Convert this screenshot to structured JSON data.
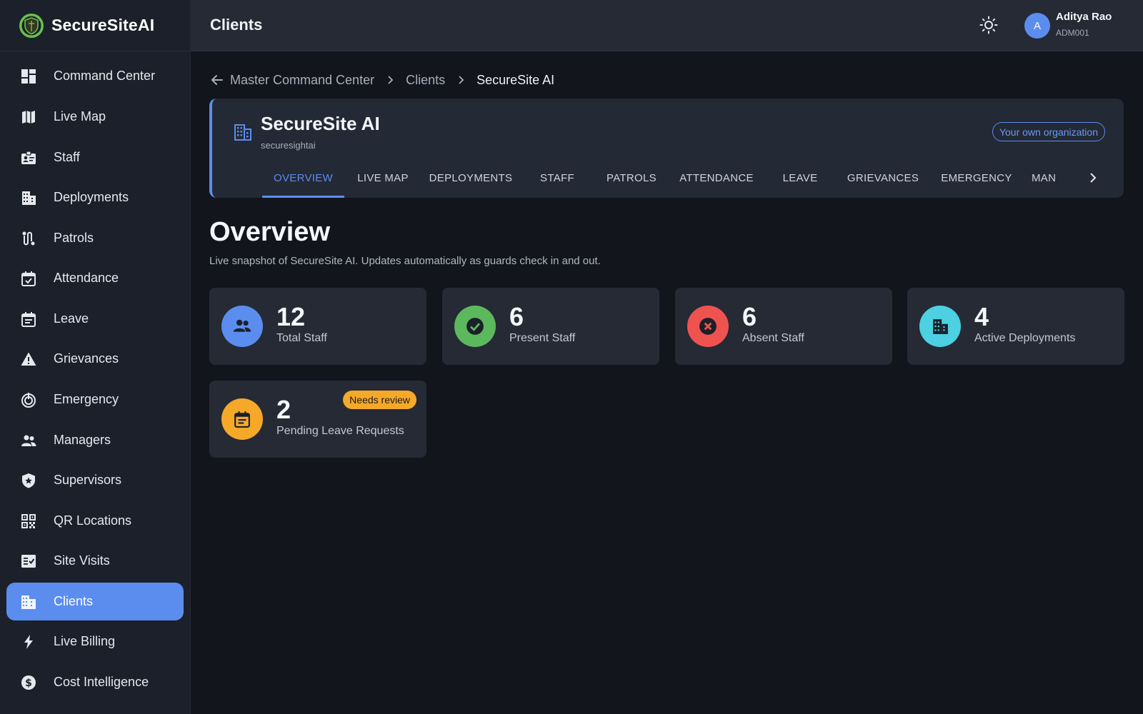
{
  "brand": {
    "name": "SecureSiteAI",
    "logo_icon": "shield-logo-icon"
  },
  "sidebar": {
    "items": [
      {
        "label": "Command Center",
        "icon": "dashboard-icon",
        "active": false
      },
      {
        "label": "Live Map",
        "icon": "map-icon",
        "active": false
      },
      {
        "label": "Staff",
        "icon": "id-badge-icon",
        "active": false
      },
      {
        "label": "Deployments",
        "icon": "building-icon",
        "active": false
      },
      {
        "label": "Patrols",
        "icon": "route-icon",
        "active": false
      },
      {
        "label": "Attendance",
        "icon": "calendar-check-icon",
        "active": false
      },
      {
        "label": "Leave",
        "icon": "calendar-icon",
        "active": false
      },
      {
        "label": "Grievances",
        "icon": "warning-icon",
        "active": false
      },
      {
        "label": "Emergency",
        "icon": "emergency-icon",
        "active": false
      },
      {
        "label": "Managers",
        "icon": "people-icon",
        "active": false
      },
      {
        "label": "Supervisors",
        "icon": "shield-star-icon",
        "active": false
      },
      {
        "label": "QR Locations",
        "icon": "qr-code-icon",
        "active": false
      },
      {
        "label": "Site Visits",
        "icon": "checklist-icon",
        "active": false
      },
      {
        "label": "Clients",
        "icon": "business-icon",
        "active": true
      },
      {
        "label": "Live Billing",
        "icon": "bolt-icon",
        "active": false
      },
      {
        "label": "Cost Intelligence",
        "icon": "dollar-icon",
        "active": false
      }
    ]
  },
  "header": {
    "title": "Clients",
    "user": {
      "initial": "A",
      "name": "Aditya Rao",
      "id": "ADM001"
    }
  },
  "breadcrumb": {
    "items": [
      "Master Command Center",
      "Clients"
    ],
    "current": "SecureSite AI"
  },
  "client": {
    "name": "SecureSite AI",
    "slug": "securesightai",
    "badge": "Your own organization",
    "tabs": [
      "OVERVIEW",
      "LIVE MAP",
      "DEPLOYMENTS",
      "STAFF",
      "PATROLS",
      "ATTENDANCE",
      "LEAVE",
      "GRIEVANCES",
      "EMERGENCY",
      "MAN"
    ],
    "active_tab": "OVERVIEW"
  },
  "overview": {
    "title": "Overview",
    "subtitle": "Live snapshot of SecureSite AI. Updates automatically as guards check in and out.",
    "stats": [
      {
        "value": "12",
        "label": "Total Staff",
        "icon": "people-icon",
        "color": "#5b8def"
      },
      {
        "value": "6",
        "label": "Present Staff",
        "icon": "check-circle-icon",
        "color": "#5cb85c"
      },
      {
        "value": "6",
        "label": "Absent Staff",
        "icon": "x-circle-icon",
        "color": "#ef5350"
      },
      {
        "value": "4",
        "label": "Active Deployments",
        "icon": "building-icon",
        "color": "#4dd0e1"
      },
      {
        "value": "2",
        "label": "Pending Leave Requests",
        "icon": "calendar-icon",
        "color": "#f6a829",
        "badge": "Needs review"
      }
    ]
  }
}
